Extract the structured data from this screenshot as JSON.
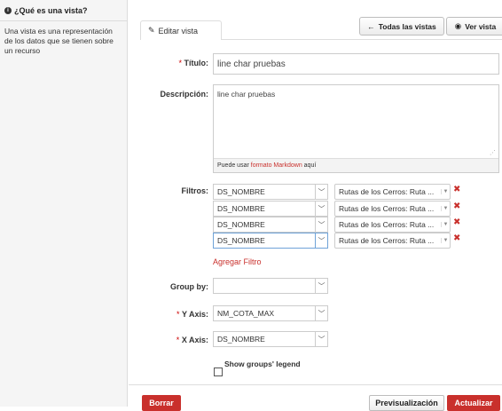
{
  "sidebar": {
    "title": "¿Qué es una vista?",
    "description": "Una vista es una representación de los datos que se tienen sobre un recurso"
  },
  "tabs": {
    "edit_view": "Editar vista"
  },
  "toolbar": {
    "all_views": "Todas las vistas",
    "view": "Ver vista"
  },
  "form": {
    "title_label": "Título:",
    "title_value": "line char pruebas",
    "description_label": "Descripción:",
    "description_value": "line char pruebas",
    "markdown_prefix": "Puede usar ",
    "markdown_link": "formato Markdown",
    "markdown_suffix": " aquí",
    "filters_label": "Filtros:",
    "filters": [
      {
        "field": "DS_NOMBRE",
        "value": "Rutas de los Cerros: Ruta ..."
      },
      {
        "field": "DS_NOMBRE",
        "value": "Rutas de los Cerros: Ruta ..."
      },
      {
        "field": "DS_NOMBRE",
        "value": "Rutas de los Cerros: Ruta ..."
      },
      {
        "field": "DS_NOMBRE",
        "value": "Rutas de los Cerros: Ruta ..."
      }
    ],
    "add_filter": "Agregar Filtro",
    "group_by_label": "Group by:",
    "group_by_value": "",
    "y_axis_label": "Y Axis:",
    "y_axis_value": "NM_COTA_MAX",
    "x_axis_label": "X Axis:",
    "x_axis_value": "DS_NOMBRE",
    "legend_label": "Show groups' legend"
  },
  "actions": {
    "delete": "Borrar",
    "preview": "Previsualización",
    "update": "Actualizar"
  },
  "colors": {
    "accent_red": "#c9302c",
    "sidebar_bg": "#f5f5f5"
  }
}
